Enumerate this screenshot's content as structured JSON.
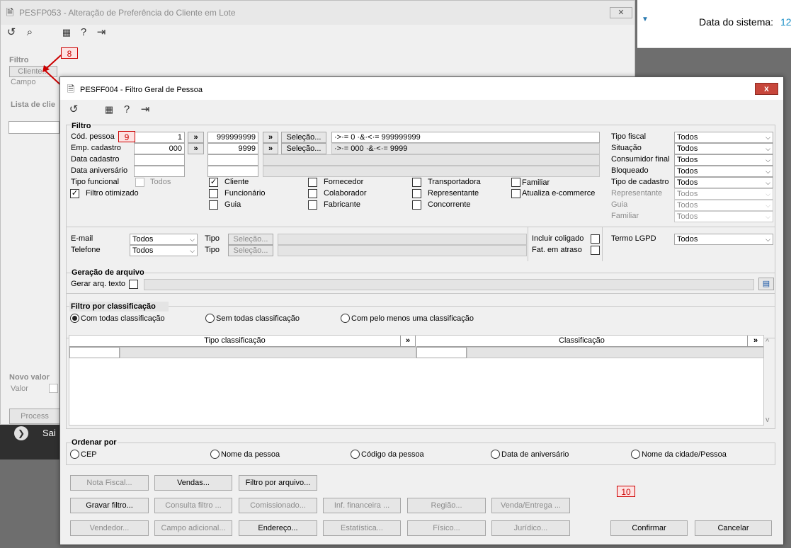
{
  "top_right": {
    "label": "Data do sistema:",
    "value": "12"
  },
  "bg_window": {
    "title": "PESFP053 - Alteração de Preferência do Cliente em Lote",
    "filtro_label": "Filtro",
    "cliente_button": "Cliente...",
    "campo_label": "Campo",
    "lista_label": "Lista de clie",
    "novo_valor_label": "Novo valor",
    "valor_label": "Valor",
    "processar_button": "Process",
    "bottom_bar_text": "Sai"
  },
  "markers": {
    "m8": "8",
    "m9": "9",
    "m10": "10"
  },
  "dialog": {
    "title": "PESFF004 - Filtro Geral de Pessoa",
    "close": "x",
    "filtro": {
      "label": "Filtro",
      "cod_pessoa_label": "Cód. pessoa",
      "cod_pessoa_from": "1",
      "cod_pessoa_to": "999999999",
      "cod_pessoa_range": "·>·= 0 ·&·<·= 999999999",
      "emp_cadastro_label": "Emp. cadastro",
      "emp_cadastro_from": "000",
      "emp_cadastro_to": "9999",
      "emp_cadastro_range": "·>·= 000 ·&·<·= 9999",
      "data_cadastro_label": "Data cadastro",
      "data_aniversario_label": "Data aniversário",
      "tipo_funcional_label": "Tipo funcional",
      "todos_label": "Todos",
      "filtro_otimizado_label": "Filtro otimizado",
      "selecao_label": "Seleção...",
      "arrow": "»",
      "types": {
        "cliente": "Cliente",
        "funcionario": "Funcionário",
        "guia": "Guia",
        "fornecedor": "Fornecedor",
        "colaborador": "Colaborador",
        "fabricante": "Fabricante",
        "transportadora": "Transportadora",
        "representante": "Representante",
        "concorrente": "Concorrente",
        "familiar": "Familiar",
        "atualiza_ecommerce": "Atualiza e-commerce"
      },
      "right": {
        "tipo_fiscal": "Tipo fiscal",
        "situacao": "Situação",
        "consumidor_final": "Consumidor final",
        "bloqueado": "Bloqueado",
        "tipo_cadastro": "Tipo de cadastro",
        "representante": "Representante",
        "guia": "Guia",
        "familiar": "Familiar",
        "value": "Todos"
      },
      "email_label": "E-mail",
      "telefone_label": "Telefone",
      "tipo_label": "Tipo",
      "incluir_coligado_label": "Incluir coligado",
      "fat_atraso_label": "Fat. em atraso",
      "termo_lgpd_label": "Termo LGPD"
    },
    "geracao": {
      "label": "Geração de arquivo",
      "gerar_label": "Gerar arq. texto"
    },
    "classificacao": {
      "label": "Filtro por classificação",
      "opt_todas": "Com todas classificação",
      "opt_sem": "Sem todas classificação",
      "opt_pelo_menos": "Com pelo menos uma classificação",
      "col_tipo": "Tipo classificação",
      "col_classificacao": "Classificação",
      "scroll_up": "^",
      "scroll_down": "v"
    },
    "ordenar": {
      "label": "Ordenar por",
      "cep": "CEP",
      "nome": "Nome da pessoa",
      "codigo": "Código da pessoa",
      "aniversario": "Data de aniversário",
      "cidade": "Nome da cidade/Pessoa"
    },
    "buttons": {
      "nota_fiscal": "Nota Fiscal...",
      "vendas": "Vendas...",
      "filtro_arquivo": "Filtro por arquivo...",
      "gravar_filtro": "Gravar filtro...",
      "consulta_filtro": "Consulta filtro ...",
      "comissionado": "Comissionado...",
      "inf_financeira": "Inf. financeira ...",
      "regiao": "Região...",
      "venda_entrega": "Venda/Entrega ...",
      "vendedor": "Vendedor...",
      "campo_adicional": "Campo adicional...",
      "endereco": "Endereço...",
      "estatistica": "Estatística...",
      "fisico": "Físico...",
      "juridico": "Jurídico...",
      "confirmar": "Confirmar",
      "cancelar": "Cancelar"
    }
  }
}
